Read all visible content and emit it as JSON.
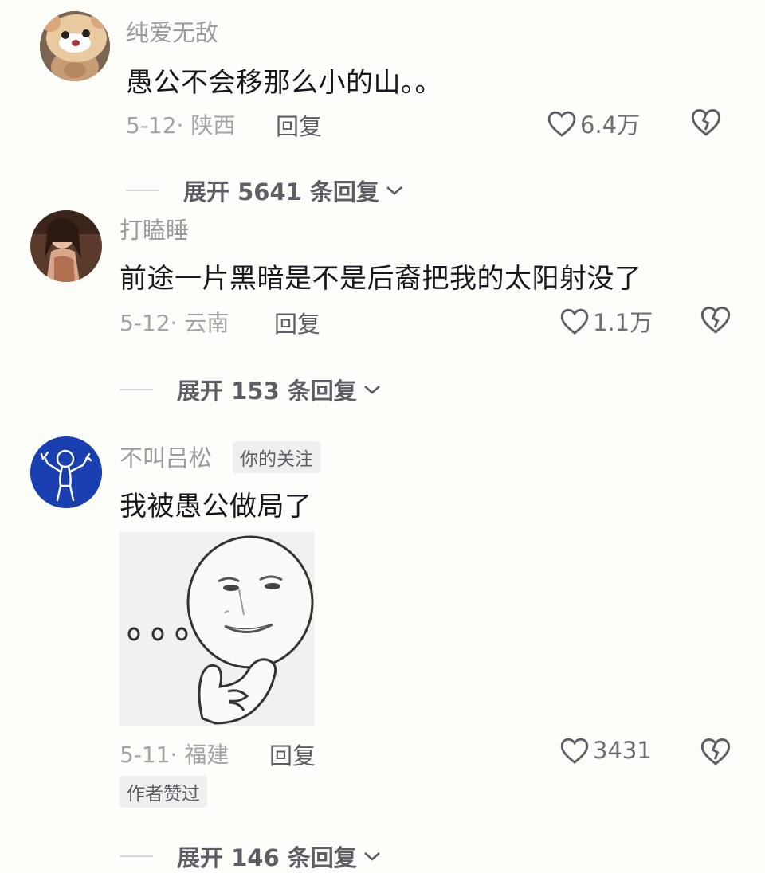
{
  "comments": [
    {
      "username": "纯爱无敌",
      "text": "愚公不会移那么小的山。。",
      "date_location": "5-12· 陕西",
      "reply_label": "回复",
      "likes": "6.4万",
      "expand_label": "展开 5641 条回复",
      "avatar_icon": "hamster-hat-avatar"
    },
    {
      "username": "打瞌睡",
      "text": "前途一片黑暗是不是后裔把我的太阳射没了",
      "date_location": "5-12· 云南",
      "reply_label": "回复",
      "likes": "1.1万",
      "expand_label": "展开 153 条回复",
      "avatar_icon": "girl-photo-avatar"
    },
    {
      "username": "不叫吕松",
      "follow_tag": "你的关注",
      "text": "我被愚公做局了",
      "sticker": "smiling-face-thumbs-up-meme",
      "date_location": "5-11· 福建",
      "reply_label": "回复",
      "likes": "3431",
      "author_liked_tag": "作者赞过",
      "expand_label": "展开 146 条回复",
      "avatar_icon": "stick-figure-avatar"
    }
  ],
  "colors": {
    "background": "#fdfdfa",
    "primary_text": "#17181d",
    "secondary_text": "#a3a4a8",
    "avatar_blue": "#1a3fb0"
  }
}
